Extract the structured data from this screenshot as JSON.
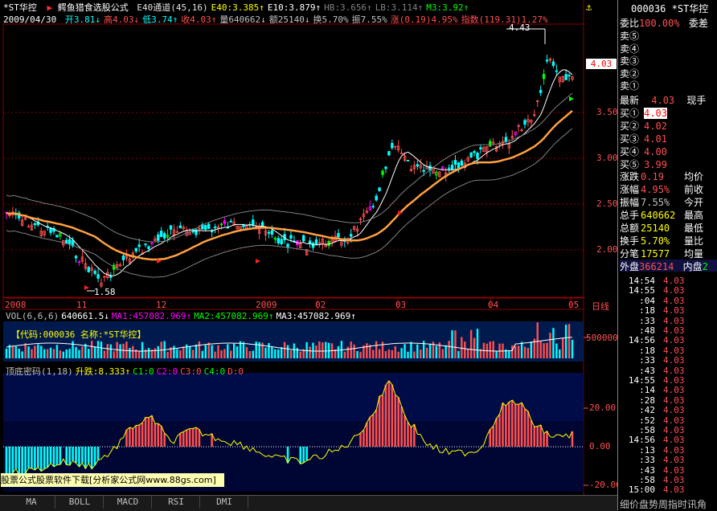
{
  "header": {
    "stock_name": "*ST华控",
    "formula_name": "鳄鱼猎食选股公式",
    "indicators": [
      {
        "text": "E40通道(45,16)",
        "color": "#e0e0e0"
      },
      {
        "text": "E40:3.385↑",
        "color": "#ffff00"
      },
      {
        "text": "E10:3.879↑",
        "color": "#ffffff"
      },
      {
        "text": "HB:3.656↑",
        "color": "#808080"
      },
      {
        "text": "LB:3.114↑",
        "color": "#808080"
      },
      {
        "text": "M3:3.92↑",
        "color": "#00ff00"
      }
    ],
    "date": "2009/04/30",
    "quote": [
      {
        "text": "开3.81↓",
        "color": "#00ffff"
      },
      {
        "text": "高4.03↓",
        "color": "#ff5050"
      },
      {
        "text": "低3.74↑",
        "color": "#00ffff"
      },
      {
        "text": "收4.03↑",
        "color": "#ff5050"
      },
      {
        "text": "量640662↓",
        "color": "#c0c0c0"
      },
      {
        "text": "额25140↓",
        "color": "#c0c0c0"
      },
      {
        "text": "换5.70%",
        "color": "#c0c0c0"
      },
      {
        "text": "振7.55%",
        "color": "#c0c0c0"
      },
      {
        "text": "涨(0.19)4.95%",
        "color": "#ff5050"
      },
      {
        "text": "指数(119.31)1.27%",
        "color": "#ff5050"
      }
    ]
  },
  "price_chart": {
    "high_label": "4.43",
    "low_label": "1.58",
    "current_price_tag": "4.03",
    "y_ticks": [
      "3.50",
      "3.00",
      "2.50",
      "2.00"
    ],
    "x_labels": [
      "2008",
      "11",
      "12",
      "2009",
      "02",
      "03",
      "04",
      "05"
    ],
    "view_mode": "日线"
  },
  "volume_panel": {
    "legend": [
      {
        "text": "VOL(6,6,6)",
        "color": "#c0c0c0"
      },
      {
        "text": "640661.5↓",
        "color": "#ffffff"
      },
      {
        "text": "MA1:457082.969↑",
        "color": "#ff00ff"
      },
      {
        "text": "MA2:457082.969↑",
        "color": "#00ff00"
      },
      {
        "text": "MA3:457082.969↑",
        "color": "#ffffff"
      }
    ],
    "code_banner": "【代码:000036 名称:*ST华控】",
    "y_tick": "500000"
  },
  "oscillator_panel": {
    "legend": [
      {
        "text": "顶底密码(1,18)",
        "color": "#c0c0c0"
      },
      {
        "text": "升跌:8.333↑",
        "color": "#ffff00"
      },
      {
        "text": "C1:0",
        "color": "#00ff00"
      },
      {
        "text": "C2:0",
        "color": "#ff00ff"
      },
      {
        "text": "C3:0",
        "color": "#ff5050"
      },
      {
        "text": "C4:0",
        "color": "#00ff00"
      },
      {
        "text": "D:0",
        "color": "#ff5050"
      }
    ],
    "y_ticks": [
      "20.00",
      "0.00",
      "-20.00"
    ]
  },
  "watermark": "股票公式股票软件下载[分析家公式网www.88gs.com]",
  "bottom_tabs": [
    "MA",
    "BOLL",
    "MACD",
    "RSI",
    "DMI"
  ],
  "side_panel": {
    "code": "000036",
    "name": "*ST华控",
    "weibi_label": "委比",
    "weibi_value": "100.00%",
    "weicha_label": "委差",
    "sell_levels": [
      "卖⑤",
      "卖④",
      "卖③",
      "卖②",
      "卖①"
    ],
    "latest_label": "最新",
    "latest_value": "4.03",
    "xianshou_label": "现手",
    "buy_levels": [
      {
        "label": "买①",
        "price": "4.03"
      },
      {
        "label": "买②",
        "price": "4.02"
      },
      {
        "label": "买③",
        "price": "4.01"
      },
      {
        "label": "买④",
        "price": "4.00"
      },
      {
        "label": "买⑤",
        "price": "3.99"
      }
    ],
    "stats": [
      {
        "label": "涨跌",
        "value": "0.19",
        "vcolor": "#ff5050",
        "label2": "均价"
      },
      {
        "label": "涨幅",
        "value": "4.95%",
        "vcolor": "#ff5050",
        "label2": "前收"
      },
      {
        "label": "振幅",
        "value": "7.55%",
        "vcolor": "#c0c0c0",
        "label2": "今开"
      },
      {
        "label": "总手",
        "value": "640662",
        "vcolor": "#ffff00",
        "label2": "最高"
      },
      {
        "label": "总额",
        "value": "25140",
        "vcolor": "#ffff00",
        "label2": "最低"
      },
      {
        "label": "换手",
        "value": "5.70%",
        "vcolor": "#ffff00",
        "label2": "量比"
      },
      {
        "label": "分笔",
        "value": "17577",
        "vcolor": "#ffff00",
        "label2": "均量"
      }
    ],
    "waipan_label": "外盘",
    "waipan_value": "366214",
    "neipan_label": "内盘",
    "neipan_value": "2",
    "ticks": [
      {
        "time": "14:54",
        "price": "4.03"
      },
      {
        "time": "14:55",
        "price": "4.03"
      },
      {
        "time": ":04",
        "price": "4.03"
      },
      {
        "time": ":18",
        "price": "4.03"
      },
      {
        "time": ":33",
        "price": "4.03"
      },
      {
        "time": ":48",
        "price": "4.03"
      },
      {
        "time": "14:56",
        "price": "4.03"
      },
      {
        "time": ":18",
        "price": "4.03"
      },
      {
        "time": ":33",
        "price": "4.03"
      },
      {
        "time": ":43",
        "price": "4.03"
      },
      {
        "time": "14:55",
        "price": "4.03"
      },
      {
        "time": ":14",
        "price": "4.03"
      },
      {
        "time": ":28",
        "price": "4.03"
      },
      {
        "time": ":42",
        "price": "4.03"
      },
      {
        "time": ":52",
        "price": "4.03"
      },
      {
        "time": ":58",
        "price": "4.03"
      },
      {
        "time": "14:56",
        "price": "4.03"
      },
      {
        "time": ":13",
        "price": "4.03"
      },
      {
        "time": ":33",
        "price": "4.03"
      },
      {
        "time": ":43",
        "price": "4.03"
      },
      {
        "time": ":58",
        "price": "4.03"
      },
      {
        "time": "15:00",
        "price": "4.03"
      }
    ],
    "footer_tabs": "细价盘势周指时讯角"
  }
}
